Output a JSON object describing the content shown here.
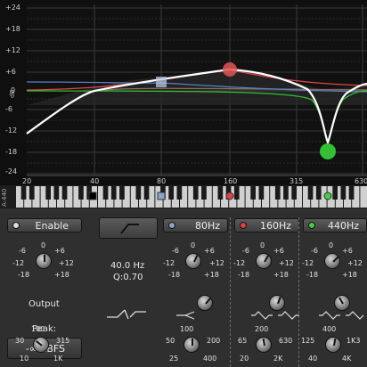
{
  "graph": {
    "y_labels": [
      "+24",
      "+18",
      "+12",
      "+6",
      "0",
      "-6",
      "-12",
      "-18",
      "-24"
    ],
    "x_labels": [
      "20",
      "40",
      "80",
      "160",
      "315",
      "630"
    ],
    "side_labels": {
      "db": "dB",
      "a440": "A:440"
    },
    "colors": {
      "curve": "#ffffff",
      "band1": "#4a78c8",
      "band2": "#e05050",
      "band3": "#39c439",
      "lowcut": "#b09070"
    }
  },
  "bands": [
    {
      "name": "band-1",
      "freq": "80Hz",
      "dot_color": "#8aa4c8"
    },
    {
      "name": "band-2",
      "freq": "160Hz",
      "dot_color": "#e04040"
    },
    {
      "name": "band-3",
      "freq": "440Hz",
      "dot_color": "#3fcf3f"
    }
  ],
  "enable": {
    "label": "Enable"
  },
  "lowcut": {
    "freq": "40.0 Hz",
    "q": "Q:0.70"
  },
  "output": {
    "label": "Output",
    "peak_label": "Peak:",
    "peak_value": "-∞ dBFS"
  },
  "gain_scale": {
    "m6": "-6",
    "zero": "0",
    "p6": "+6",
    "m12": "-12",
    "p12": "+12",
    "m18": "-18",
    "p18": "+18"
  },
  "freq_scales": {
    "output": {
      "top": "100",
      "left": "30",
      "right": "315",
      "bl": "10",
      "br": "1K"
    },
    "b1": {
      "top": "100",
      "left": "50",
      "right": "200",
      "bl": "25",
      "br": "400"
    },
    "b2": {
      "top": "200",
      "left": "65",
      "right": "630",
      "bl": "20",
      "br": "2K"
    },
    "b3": {
      "top": "400",
      "left": "125",
      "right": "1K3",
      "bl": "40",
      "br": "4K"
    }
  }
}
